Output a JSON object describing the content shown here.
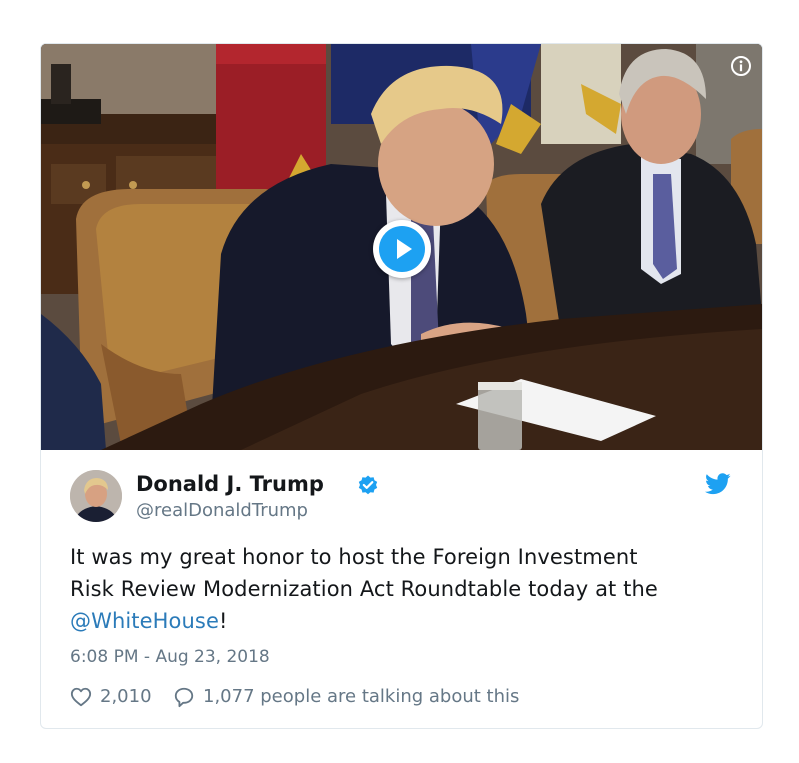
{
  "media": {
    "type": "video",
    "play_icon": "play-icon",
    "info_icon": "info-icon"
  },
  "author": {
    "display_name": "Donald J. Trump",
    "handle": "@realDonaldTrump",
    "verified": true,
    "verified_icon": "verified-badge-icon",
    "avatar_icon": "avatar"
  },
  "brand": {
    "logo_icon": "twitter-bird-icon",
    "accent_color": "#1da1f2",
    "link_color": "#2b7bb9",
    "text_color": "#14171a",
    "muted_color": "#657786"
  },
  "tweet": {
    "line1": "It was my great honor to host the Foreign Investment",
    "line2": "Risk Review Modernization Act Roundtable today at the",
    "mention": "@WhiteHouse",
    "after_mention": "!",
    "timestamp": "6:08 PM - Aug 23, 2018"
  },
  "actions": {
    "like_icon": "heart-icon",
    "like_count": "2,010",
    "reply_icon": "speech-bubble-icon",
    "talking_text": "1,077 people are talking about this"
  }
}
